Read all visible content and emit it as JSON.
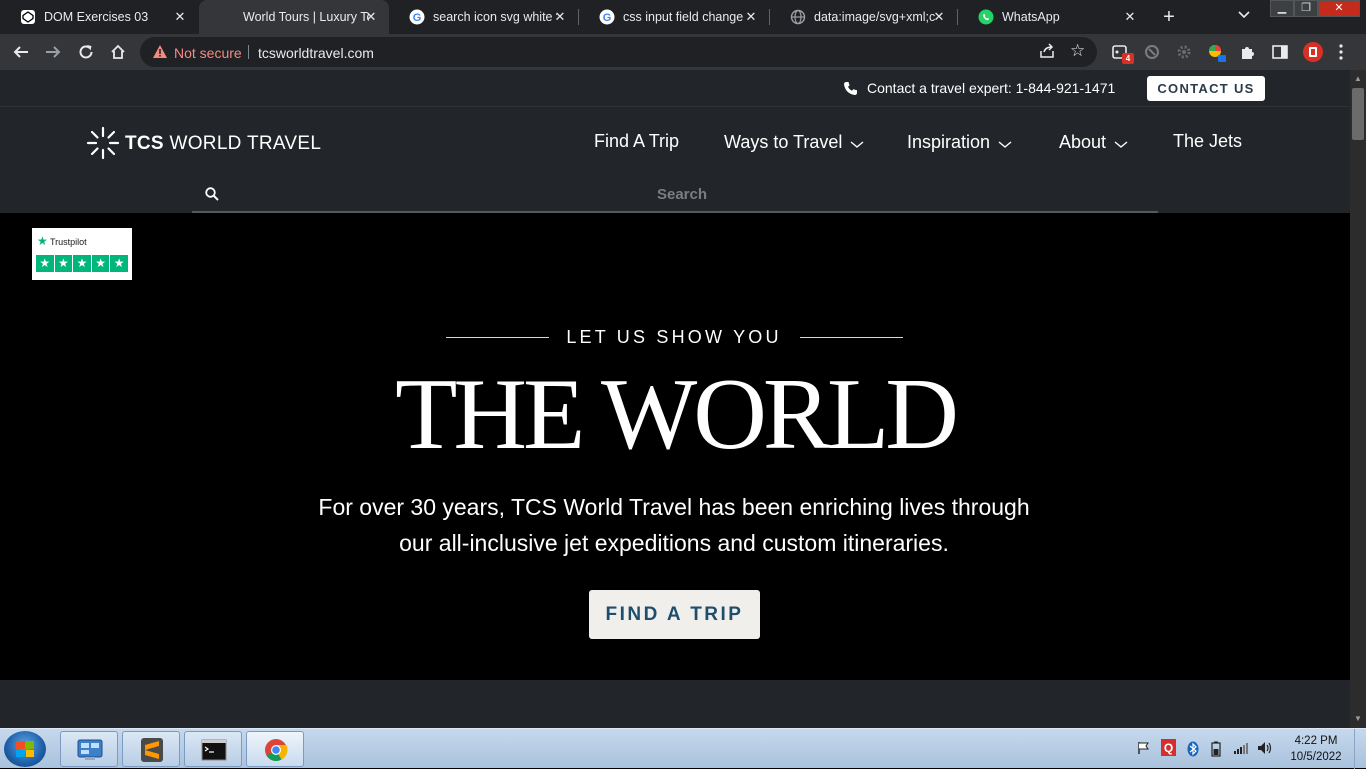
{
  "browser": {
    "tabs": [
      {
        "title": "DOM Exercises 03",
        "icon": "codepen-icon"
      },
      {
        "title": "World Tours | Luxury Tours",
        "icon": "tcs-icon"
      },
      {
        "title": "search icon svg white th",
        "icon": "google-icon"
      },
      {
        "title": "css input field change -",
        "icon": "google-icon"
      },
      {
        "title": "data:image/svg+xml;ch",
        "icon": "globe-icon"
      },
      {
        "title": "WhatsApp",
        "icon": "whatsapp-icon"
      }
    ],
    "active_tab": 1,
    "not_secure": "Not secure",
    "url": "tcsworldtravel.com",
    "extension_badge": "4"
  },
  "site": {
    "contact_text": "Contact a travel expert: 1-844-921-1471",
    "contact_button": "CONTACT US",
    "logo_bold": "TCS",
    "logo_rest": " WORLD TRAVEL",
    "nav": [
      {
        "label": "Find A Trip",
        "dropdown": false
      },
      {
        "label": "Ways to Travel",
        "dropdown": true
      },
      {
        "label": "Inspiration",
        "dropdown": true
      },
      {
        "label": "About",
        "dropdown": true
      },
      {
        "label": "The Jets",
        "dropdown": false
      }
    ],
    "search_placeholder": "Search",
    "trustpilot": "Trustpilot",
    "trustpilot_stars": 5,
    "eyebrow": "LET US SHOW YOU",
    "headline": "THE WORLD",
    "subline1": "For over 30 years, TCS World Travel has been enriching lives through",
    "subline2": "our all-inclusive jet expeditions and custom itineraries.",
    "cta": "FIND A TRIP"
  },
  "taskbar": {
    "time": "4:22 PM",
    "date": "10/5/2022"
  },
  "colors": {
    "header_bg": "#222529",
    "hero_bg": "#000000",
    "button_text": "#1f4e6d",
    "trustpilot_green": "#00b67a"
  }
}
